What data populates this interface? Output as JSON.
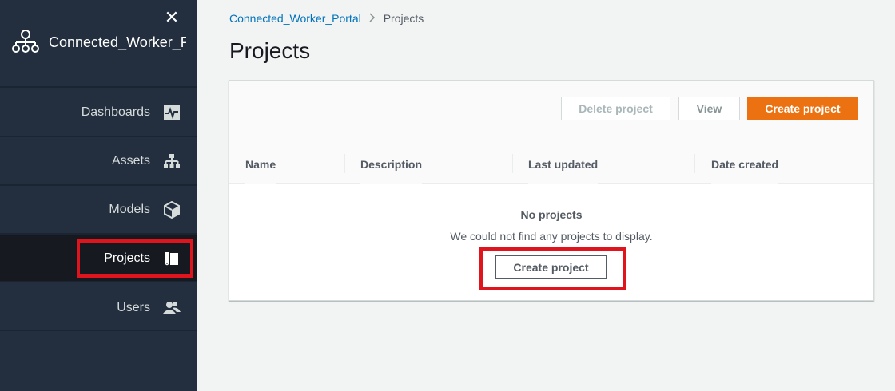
{
  "sidebar": {
    "close_glyph": "✕",
    "brand_title": "Connected_Worker_P",
    "items": [
      {
        "label": "Dashboards",
        "icon": "dashboard-icon"
      },
      {
        "label": "Assets",
        "icon": "hierarchy-icon"
      },
      {
        "label": "Models",
        "icon": "cube-icon"
      },
      {
        "label": "Projects",
        "icon": "projects-icon",
        "active": true
      },
      {
        "label": "Users",
        "icon": "users-icon"
      }
    ]
  },
  "breadcrumb": {
    "parent": "Connected_Worker_Portal",
    "current": "Projects"
  },
  "page": {
    "title": "Projects"
  },
  "toolbar": {
    "delete_label": "Delete project",
    "view_label": "View",
    "create_label": "Create project"
  },
  "table": {
    "columns": [
      "Name",
      "Description",
      "Last updated",
      "Date created"
    ]
  },
  "empty_state": {
    "title": "No projects",
    "description": "We could not find any projects to display.",
    "button_label": "Create project"
  },
  "colors": {
    "sidebar_bg": "#232f3e",
    "primary": "#ec7211",
    "link": "#0073bb",
    "highlight": "#e0141c"
  }
}
